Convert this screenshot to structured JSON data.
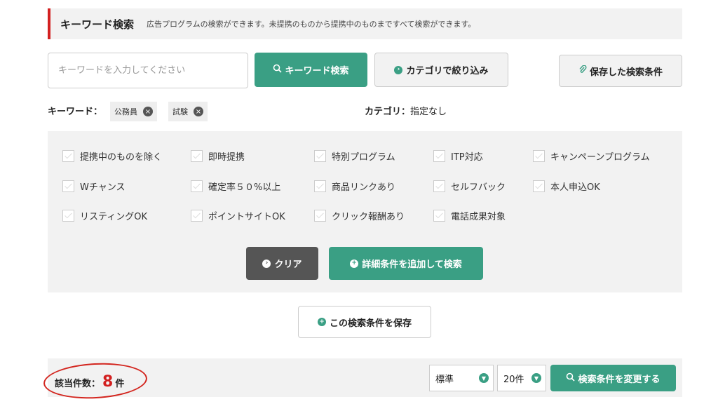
{
  "header": {
    "title": "キーワード検索",
    "description": "広告プログラムの検索ができます。未提携のものから提携中のものまですべて検索ができます。"
  },
  "search": {
    "placeholder": "キーワードを入力してください",
    "keyword_button": "キーワード検索",
    "category_button": "カテゴリで絞り込み",
    "saved_button": "保存した検索条件"
  },
  "keywords": {
    "label": "キーワード：",
    "tags": [
      "公務員",
      "試験"
    ]
  },
  "category": {
    "label": "カテゴリ：",
    "value": "指定なし"
  },
  "filters": {
    "items": [
      "提携中のものを除く",
      "即時提携",
      "特別プログラム",
      "ITP対応",
      "キャンペーンプログラム",
      "Wチャンス",
      "確定率５０%以上",
      "商品リンクあり",
      "セルフバック",
      "本人申込OK",
      "リスティングOK",
      "ポイントサイトOK",
      "クリック報酬あり",
      "電話成果対象"
    ],
    "clear_button": "クリア",
    "detail_button": "詳細条件を追加して検索"
  },
  "save_condition_button": "この検索条件を保存",
  "results": {
    "label": "該当件数：",
    "count": "8",
    "unit": "件",
    "sort_value": "標準",
    "per_page_value": "20件",
    "change_button": "検索条件を変更する"
  },
  "colors": {
    "accent_green": "#3a9f84",
    "accent_red": "#d32020"
  }
}
